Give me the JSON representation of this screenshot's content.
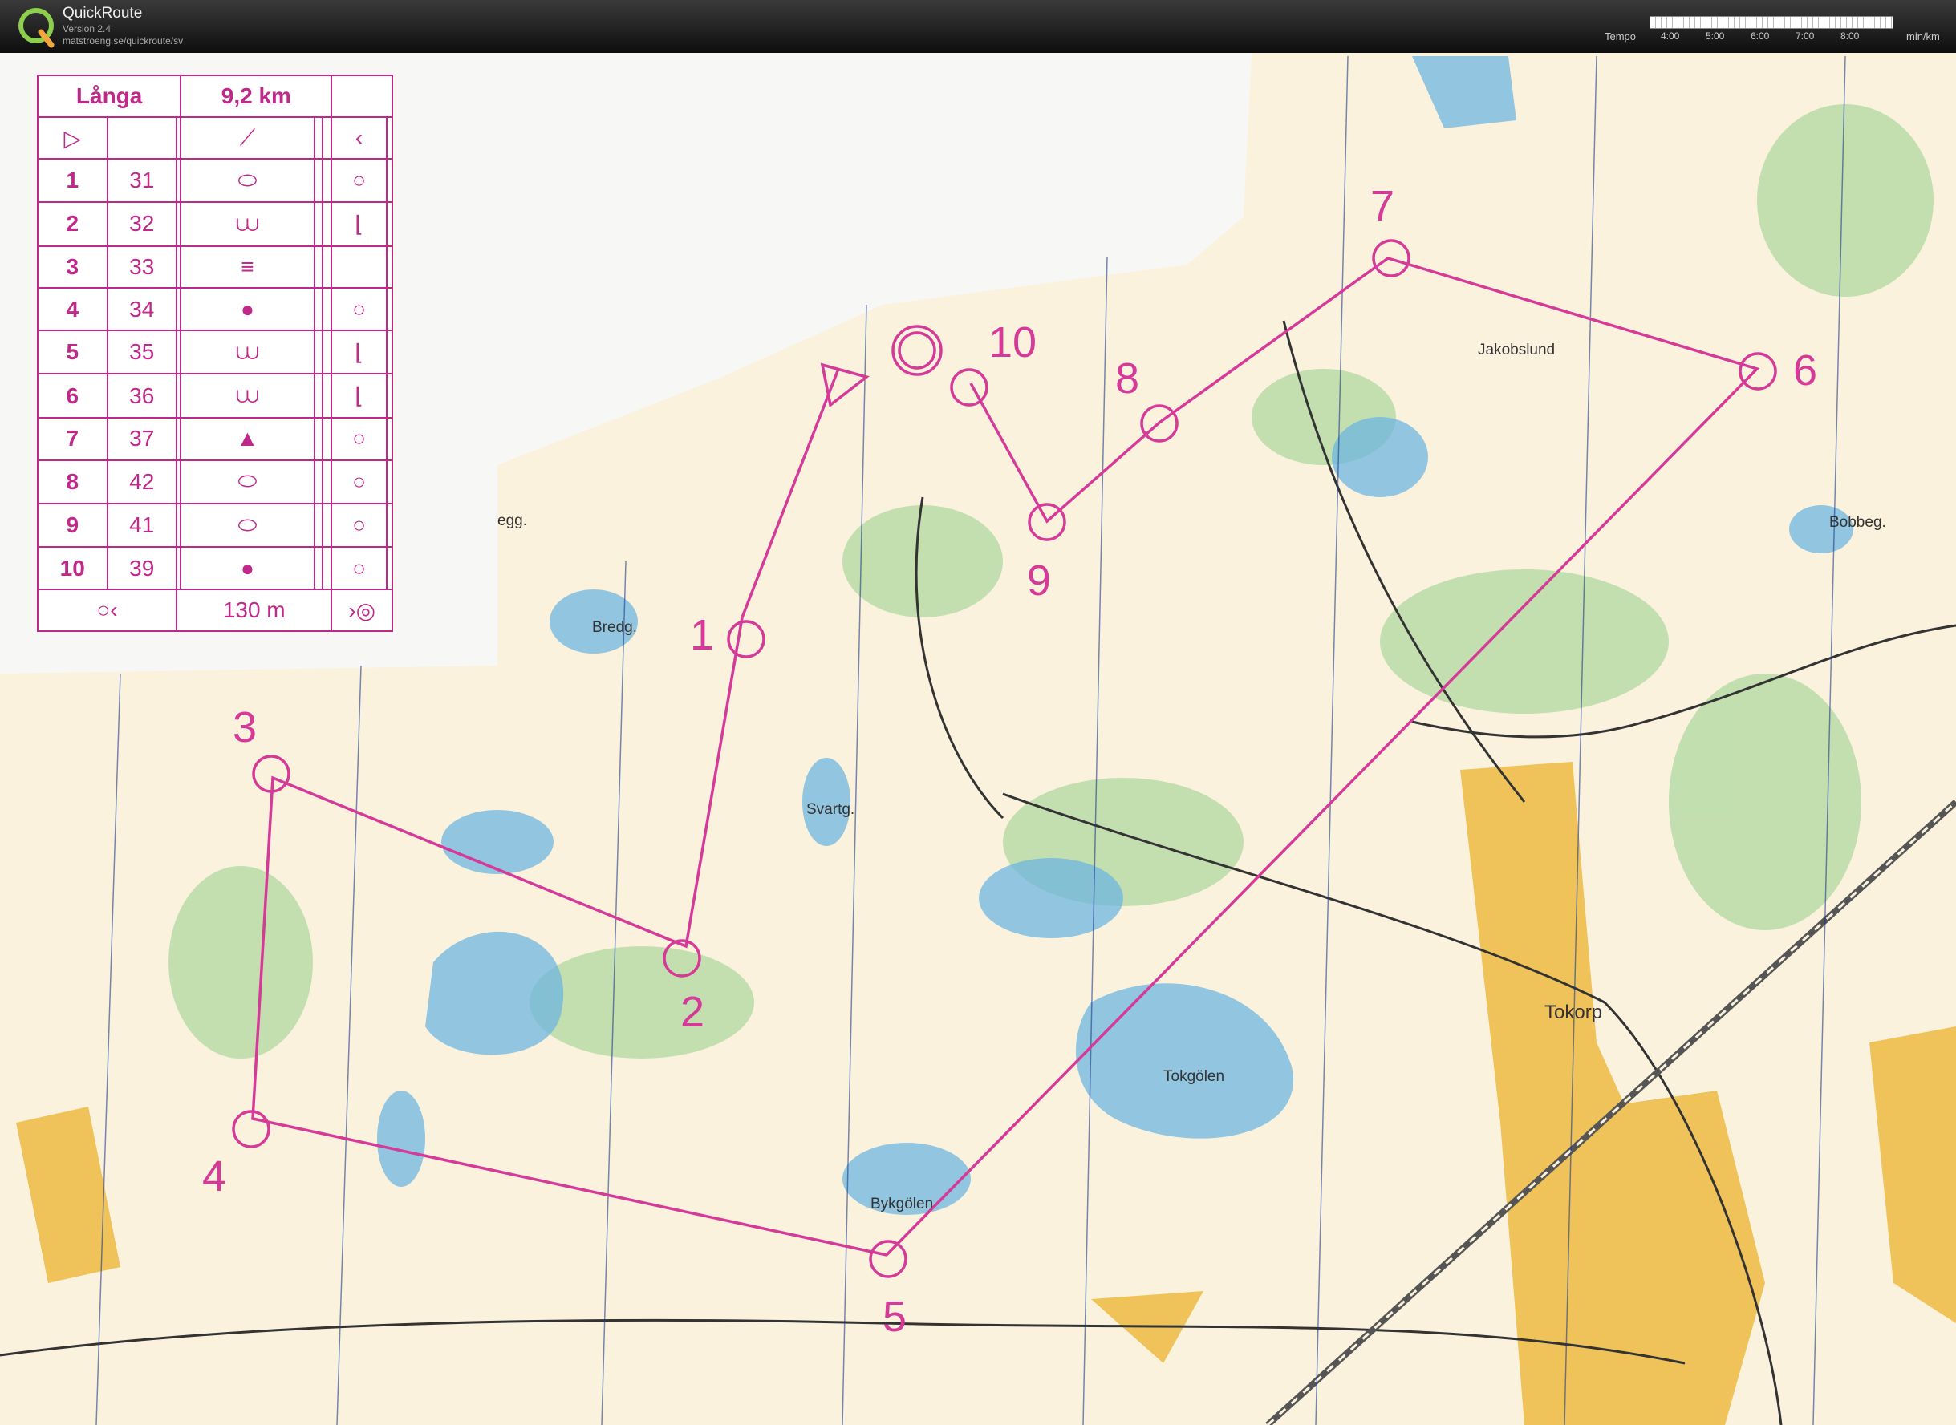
{
  "header": {
    "app_name": "QuickRoute",
    "version": "Version 2.4",
    "url": "matstroeng.se/quickroute/sv",
    "tempo_label": "Tempo",
    "tempo_ticks": [
      "4:00",
      "5:00",
      "6:00",
      "7:00",
      "8:00"
    ],
    "tempo_unit": "min/km"
  },
  "course": {
    "name": "Långa",
    "length": "9,2 km",
    "finish_distance": "130 m",
    "controls": [
      {
        "num": "1",
        "code": "31"
      },
      {
        "num": "2",
        "code": "32"
      },
      {
        "num": "3",
        "code": "33"
      },
      {
        "num": "4",
        "code": "34"
      },
      {
        "num": "5",
        "code": "35"
      },
      {
        "num": "6",
        "code": "36"
      },
      {
        "num": "7",
        "code": "37"
      },
      {
        "num": "8",
        "code": "42"
      },
      {
        "num": "9",
        "code": "41"
      },
      {
        "num": "10",
        "code": "39"
      }
    ]
  },
  "map": {
    "place_names": [
      "Jakobslund",
      "Bobbeg.",
      "Bredg.",
      "Svartg.",
      "Tokgölen",
      "Bykgölen",
      "Tokorp",
      "egg."
    ],
    "control_labels": [
      "1",
      "2",
      "3",
      "4",
      "5",
      "6",
      "7",
      "8",
      "9",
      "10"
    ],
    "colors": {
      "course": "#d63a98",
      "water": "#6fb6e0",
      "open": "#f2c14e",
      "forest": "#a8d49a"
    }
  }
}
